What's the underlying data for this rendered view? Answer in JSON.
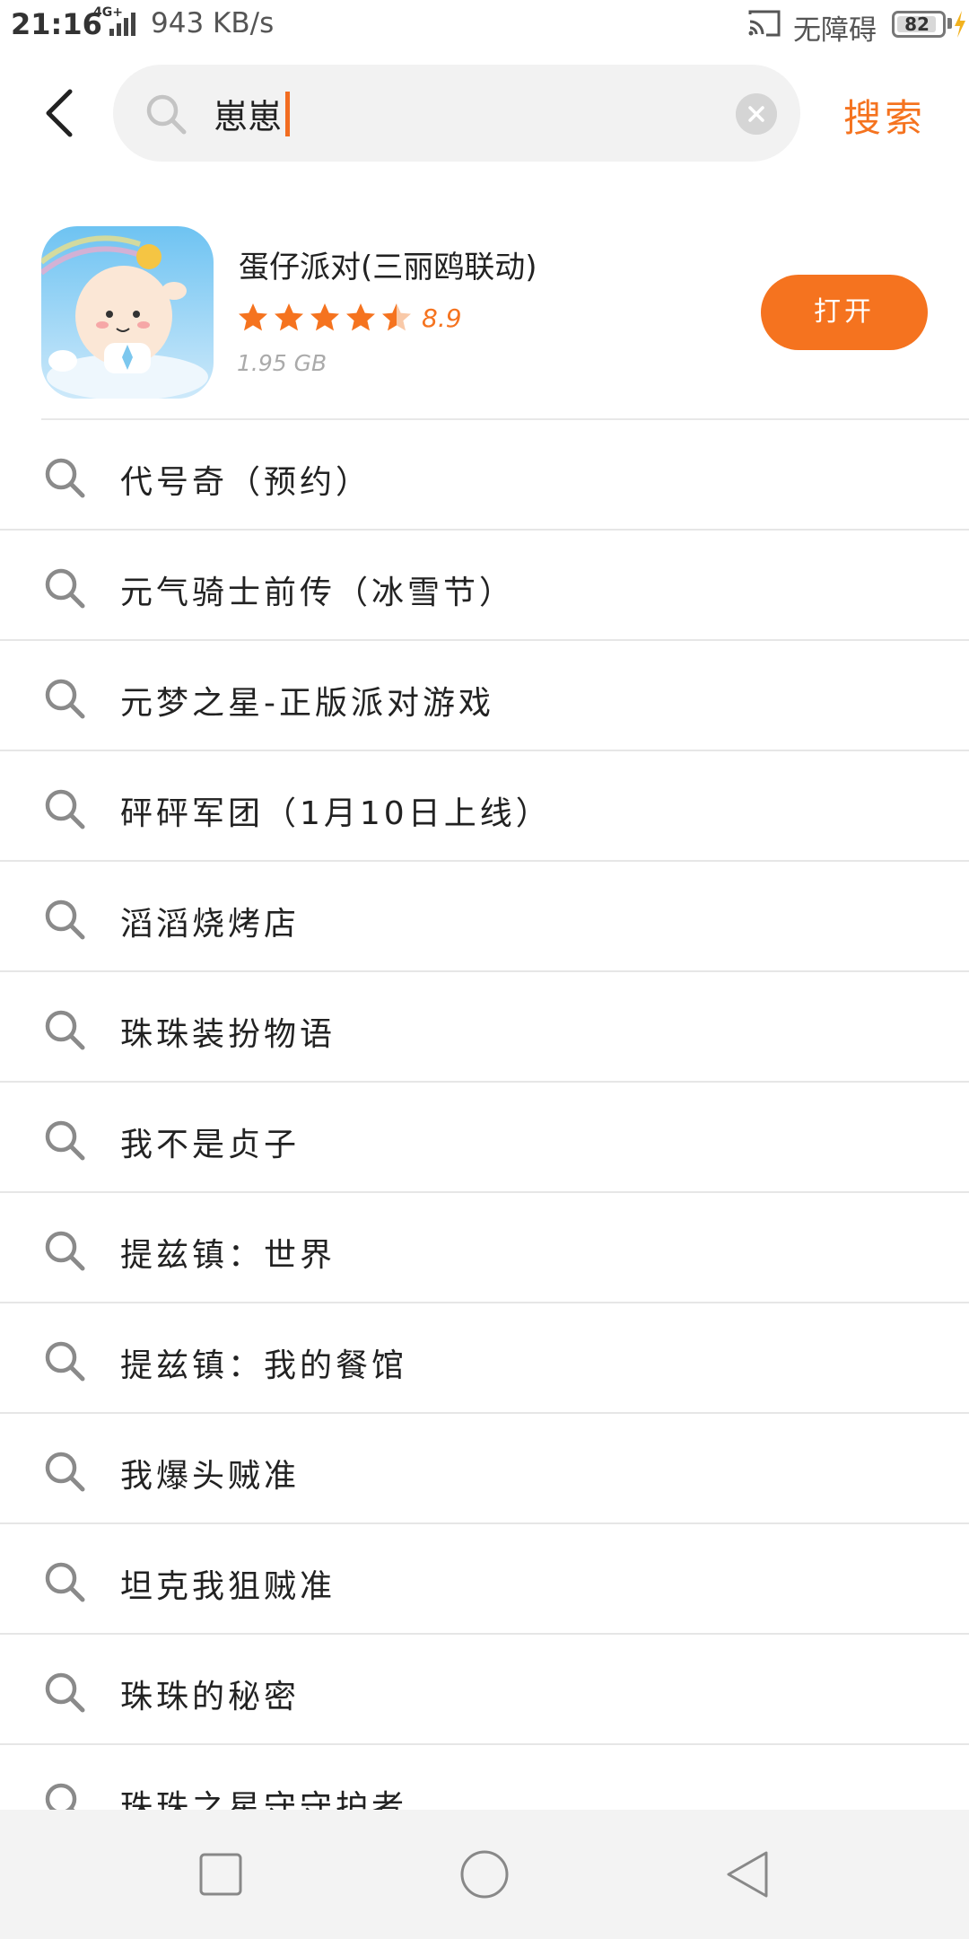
{
  "status_bar": {
    "time": "21:16",
    "network": "4G+",
    "speed": "943 KB/s",
    "accessibility": "无障碍",
    "battery": "82"
  },
  "search": {
    "query": "崽崽",
    "submit_label": "搜索"
  },
  "app_result": {
    "name": "蛋仔派对(三丽鸥联动)",
    "rating": "8.9",
    "rating_fraction": 0.9,
    "size": "1.95 GB",
    "open_label": "打开"
  },
  "suggestions": [
    "代号奇（预约）",
    "元气骑士前传（冰雪节）",
    "元梦之星-正版派对游戏",
    "砰砰军团（1月10日上线）",
    "滔滔烧烤店",
    "珠珠装扮物语",
    "我不是贞子",
    "提兹镇：世界",
    "提兹镇：我的餐馆",
    "我爆头贼准",
    "坦克我狙贼准",
    "珠珠的秘密",
    "珠珠之星守守护者"
  ],
  "colors": {
    "accent": "#f5731f",
    "divider": "#e6e6e6",
    "search_bg": "#f2f2f2"
  }
}
